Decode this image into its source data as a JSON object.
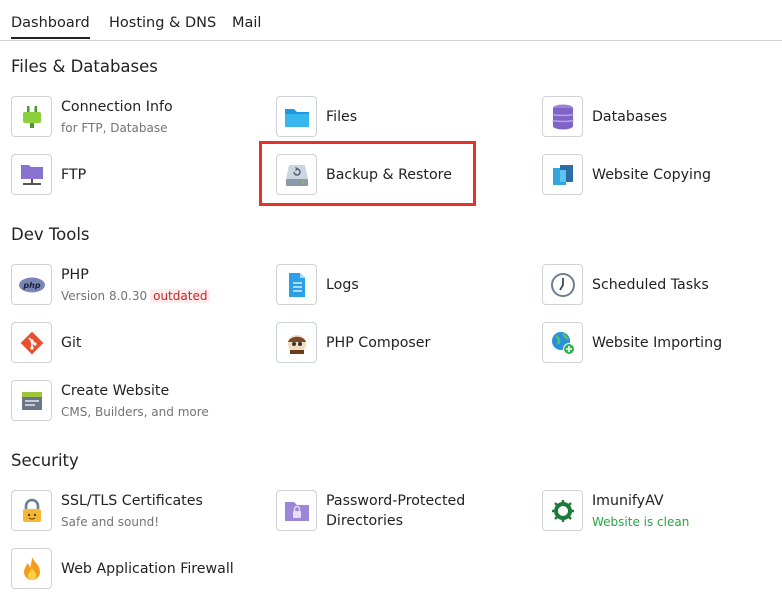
{
  "tabs": [
    "Dashboard",
    "Hosting & DNS",
    "Mail"
  ],
  "sections": {
    "files": {
      "title": "Files & Databases",
      "items": {
        "connection_info": {
          "label": "Connection Info",
          "sub": "for FTP, Database"
        },
        "files": {
          "label": "Files"
        },
        "databases": {
          "label": "Databases"
        },
        "ftp": {
          "label": "FTP"
        },
        "backup": {
          "label": "Backup & Restore"
        },
        "website_copying": {
          "label": "Website Copying"
        }
      }
    },
    "dev": {
      "title": "Dev Tools",
      "items": {
        "php": {
          "label": "PHP",
          "sub": "Version 8.0.30",
          "badge": "outdated"
        },
        "logs": {
          "label": "Logs"
        },
        "scheduled_tasks": {
          "label": "Scheduled Tasks"
        },
        "git": {
          "label": "Git"
        },
        "php_composer": {
          "label": "PHP Composer"
        },
        "website_importing": {
          "label": "Website Importing"
        },
        "create_website": {
          "label": "Create Website",
          "sub": "CMS, Builders, and more"
        }
      }
    },
    "security": {
      "title": "Security",
      "items": {
        "ssl": {
          "label": "SSL/TLS Certificates",
          "sub": "Safe and sound!"
        },
        "password_dirs": {
          "label_line1": "Password-Protected",
          "label_line2": "Directories"
        },
        "imunify": {
          "label": "ImunifyAV",
          "sub": "Website is clean"
        },
        "waf": {
          "label": "Web Application Firewall"
        }
      }
    }
  },
  "icons": {
    "connection_info": "plug-icon",
    "files": "folder-icon",
    "databases": "database-icon",
    "ftp": "ftp-folder-icon",
    "backup": "backup-drive-icon",
    "website_copying": "copy-pages-icon",
    "php": "php-logo-icon",
    "logs": "log-document-icon",
    "scheduled_tasks": "clock-icon",
    "git": "git-logo-icon",
    "php_composer": "composer-logo-icon",
    "website_importing": "globe-import-icon",
    "create_website": "create-website-icon",
    "ssl": "lock-icon",
    "password_dirs": "locked-folder-icon",
    "imunify": "imunify-shield-icon",
    "waf": "flame-icon"
  },
  "colors": {
    "highlight": "#e5332a",
    "badge_text": "#c62828",
    "badge_bg": "#fdecec",
    "clean_green": "#28a745"
  }
}
